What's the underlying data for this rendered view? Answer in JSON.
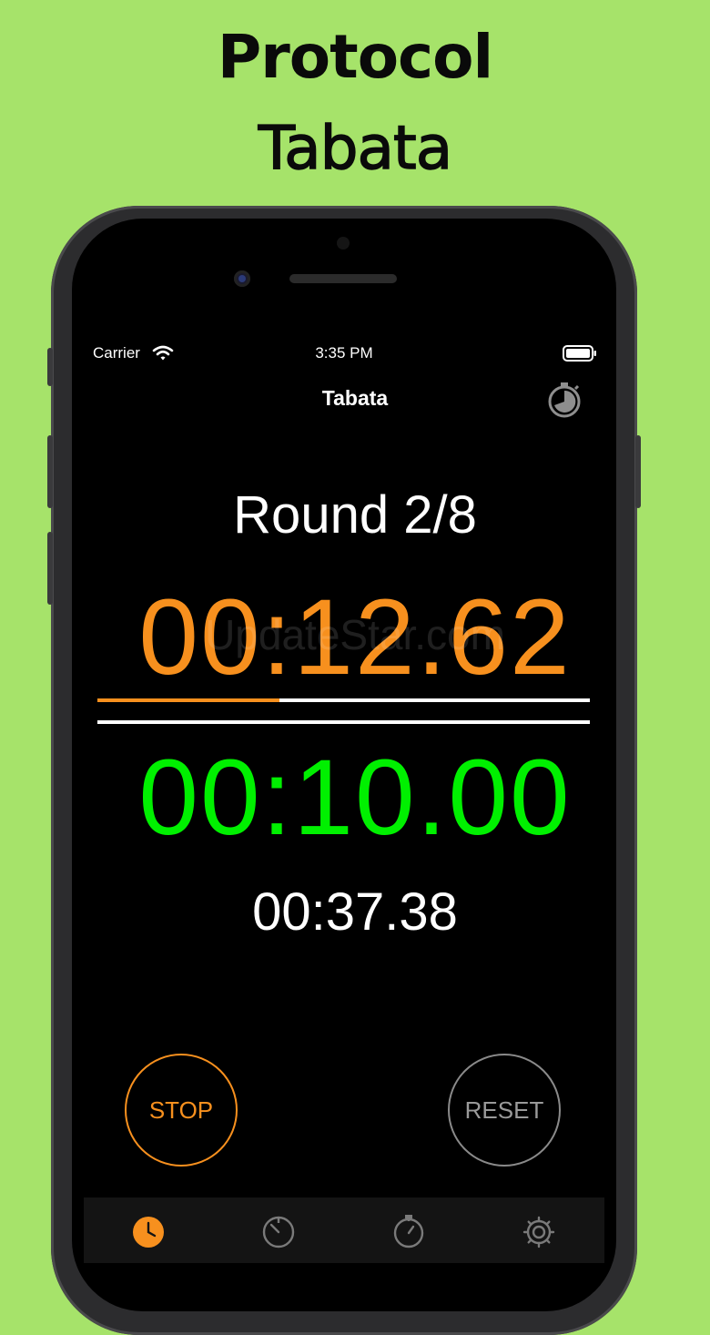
{
  "promo": {
    "line1": "Protocol",
    "line2": "Tabata"
  },
  "status_bar": {
    "carrier": "Carrier",
    "time": "3:35 PM"
  },
  "nav": {
    "title": "Tabata"
  },
  "timer": {
    "round": "Round 2/8",
    "interval": "00:12.62",
    "rest": "00:10.00",
    "total": "00:37.38",
    "interval_progress": 0.37
  },
  "watermark": "UpdateStar.com",
  "controls": {
    "stop_label": "STOP",
    "reset_label": "RESET"
  },
  "tabs": [
    {
      "icon": "clock-icon",
      "active": true
    },
    {
      "icon": "timer-icon",
      "active": false
    },
    {
      "icon": "stopwatch-icon",
      "active": false
    },
    {
      "icon": "gear-icon",
      "active": false
    }
  ],
  "colors": {
    "background": "#a6e36a",
    "accent": "#f7901e",
    "green": "#00f000"
  }
}
